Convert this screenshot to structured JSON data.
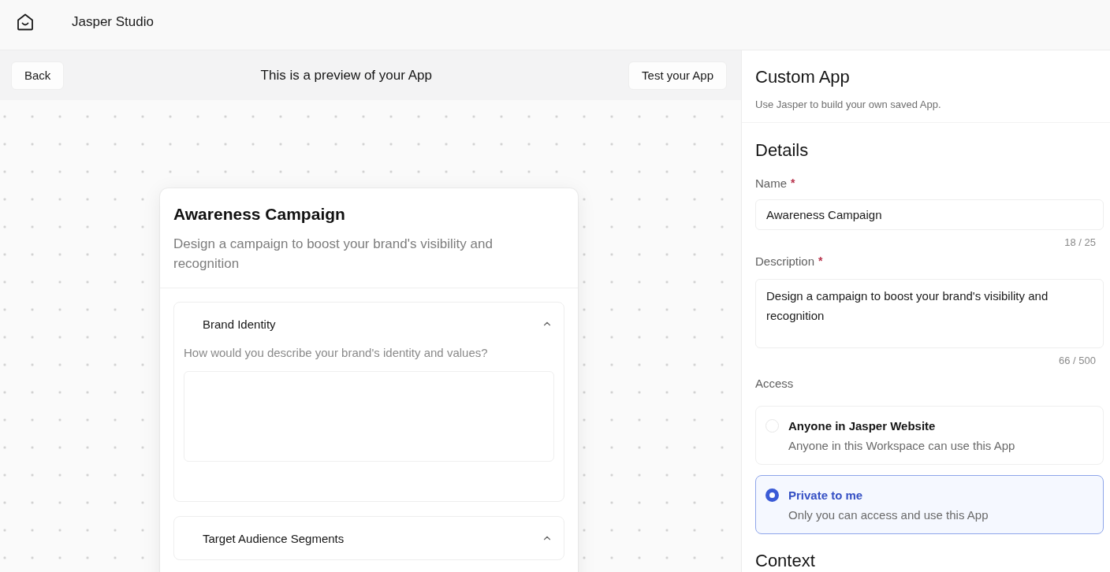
{
  "top_bar": {
    "title": "Jasper Studio"
  },
  "preview_header": {
    "back_button": "Back",
    "title": "This is a preview of your App",
    "test_button": "Test your App"
  },
  "preview_card": {
    "title": "Awareness Campaign",
    "description": "Design a campaign to boost your brand's visibility and recognition",
    "sections": [
      {
        "heading": "Brand Identity",
        "expanded": true,
        "question": "How would you describe your brand's identity and values?"
      },
      {
        "heading": "Target Audience Segments",
        "expanded": true
      }
    ]
  },
  "side_panel": {
    "title": "Custom App",
    "subtitle": "Use Jasper to build your own saved App.",
    "details_heading": "Details",
    "fields": [
      {
        "kind": "input",
        "label": "Name",
        "required_mark": "*",
        "value": "Awareness Campaign",
        "counter": "18 / 25"
      },
      {
        "kind": "textarea",
        "label": "Description",
        "required_mark": "*",
        "value": "Design a campaign to boost your brand's visibility and recognition",
        "counter": "66 / 500"
      }
    ],
    "access": {
      "label": "Access",
      "options": [
        {
          "title": "Anyone in Jasper Website",
          "description": "Anyone in this Workspace can use this App",
          "selected": false
        },
        {
          "title": "Private to me",
          "description": "Only you can access and use this App",
          "selected": true
        }
      ]
    },
    "context_heading": "Context"
  }
}
